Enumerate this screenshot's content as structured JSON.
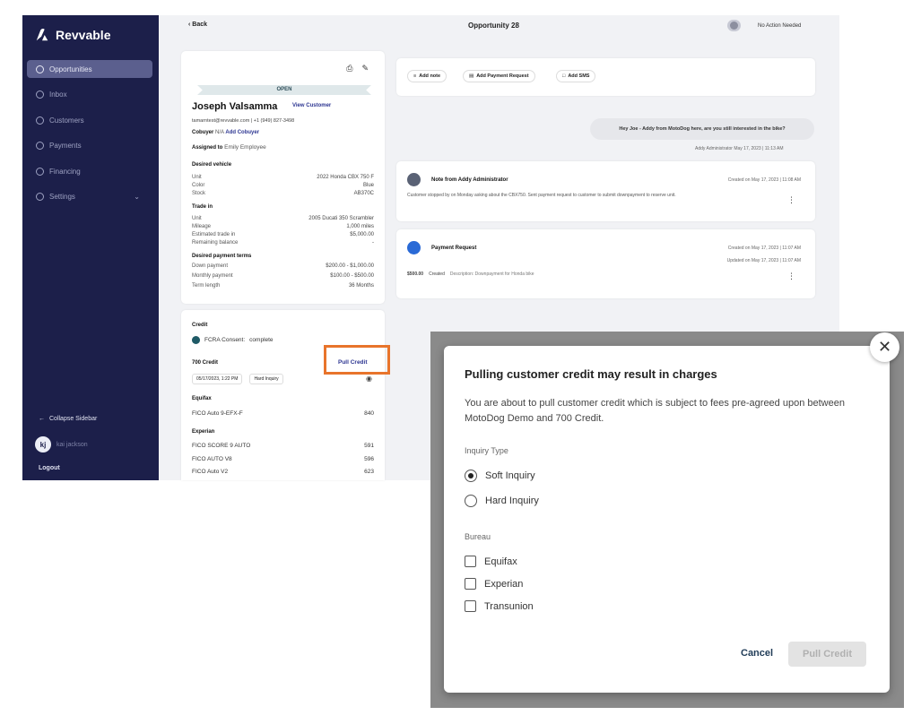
{
  "app": {
    "brand": "Revvable",
    "nav": [
      {
        "label": "Opportunities",
        "icon": "target-icon",
        "active": true
      },
      {
        "label": "Inbox",
        "icon": "inbox-icon"
      },
      {
        "label": "Customers",
        "icon": "customers-icon"
      },
      {
        "label": "Payments",
        "icon": "payments-icon"
      },
      {
        "label": "Financing",
        "icon": "financing-icon"
      },
      {
        "label": "Settings",
        "icon": "gear-icon"
      }
    ],
    "collapse_label": "Collapse Sidebar",
    "user_initials": "kj",
    "user_name": "kai jackson",
    "logout": "Logout"
  },
  "topbar": {
    "back": "Back",
    "title": "Opportunity 28",
    "status_label": "No Action Needed"
  },
  "customer": {
    "status": "OPEN",
    "name": "Joseph Valsamma",
    "view_link": "View Customer",
    "contact": "tamarntest@revvable.com | +1 (949) 827-3498",
    "cobuyer_label": "Cobuyer",
    "cobuyer_value": "N/A",
    "add_cobuyer": "Add Cobuyer",
    "assigned_label": "Assigned to",
    "assigned_value": "Emily Employee",
    "desired_vehicle_title": "Desired vehicle",
    "desired_vehicle": [
      {
        "k": "Unit",
        "v": "2022 Honda CBX 750 F"
      },
      {
        "k": "Color",
        "v": "Blue"
      },
      {
        "k": "Stock",
        "v": "AB370C"
      }
    ],
    "trade_in_title": "Trade in",
    "trade_in": [
      {
        "k": "Unit",
        "v": "2005 Ducati 350 Scrambler"
      },
      {
        "k": "Mileage",
        "v": "1,000 miles"
      },
      {
        "k": "Estimated trade in",
        "v": "$5,000.00"
      },
      {
        "k": "Remaining balance",
        "v": "-"
      }
    ],
    "payment_terms_title": "Desired payment terms",
    "payment_terms": [
      {
        "k": "Down payment",
        "v": "$200.00 - $1,000.00"
      },
      {
        "k": "Monthly payment",
        "v": "$100.00 - $500.00"
      },
      {
        "k": "Term length",
        "v": "36 Months"
      }
    ]
  },
  "credit": {
    "title": "Credit",
    "consent": "FCRA Consent:",
    "consent_status": "complete",
    "provider": "700 Credit",
    "pull_credit": "Pull Credit",
    "date_chip": "05/17/2023, 1:22 PM",
    "inquiry_chip": "Hard Inquiry",
    "equifax_title": "Equifax",
    "equifax": [
      {
        "k": "FICO Auto 9-EFX-F",
        "v": "840"
      }
    ],
    "experian_title": "Experian",
    "experian": [
      {
        "k": "FICO SCORE 9 AUTO",
        "v": "591"
      },
      {
        "k": "FICO AUTO V8",
        "v": "596"
      },
      {
        "k": "FICO Auto V2",
        "v": "623"
      }
    ]
  },
  "actions": {
    "add_note": "Add note",
    "add_payment_request": "Add Payment Request",
    "add_sms": "Add SMS"
  },
  "chat": {
    "message": "Hey Joe - Addy from MotoDog here, are you still interested in the bike?",
    "meta": "Addy Administrator  May 17, 2023 | 11:13 AM"
  },
  "note": {
    "title": "Note from Addy Administrator",
    "meta": "Created on May 17, 2023 | 11:08 AM",
    "body": "Customer stopped by on Monday asking about the CBX750. Sent payment request to customer to submit downpayment to reserve unit."
  },
  "payment": {
    "title": "Payment Request",
    "created": "Created on May 17, 2023 | 11:07 AM",
    "updated": "Updated on May 17, 2023 | 11:07 AM",
    "amount": "$500.00",
    "status": "Created",
    "description": "Description: Downpayment for Honda bike"
  },
  "modal": {
    "title": "Pulling customer credit may result in charges",
    "description": "You are about to pull customer credit which is subject to fees pre-agreed upon between MotoDog Demo and 700 Credit.",
    "inquiry_type_label": "Inquiry Type",
    "soft_inquiry": "Soft Inquiry",
    "hard_inquiry": "Hard Inquiry",
    "bureau_label": "Bureau",
    "bureaus": [
      "Equifax",
      "Experian",
      "Transunion"
    ],
    "cancel": "Cancel",
    "submit": "Pull Credit"
  },
  "colors": {
    "sidebar": "#1c1f4a",
    "accent_link": "#2c3591",
    "highlight": "#e8742b"
  }
}
